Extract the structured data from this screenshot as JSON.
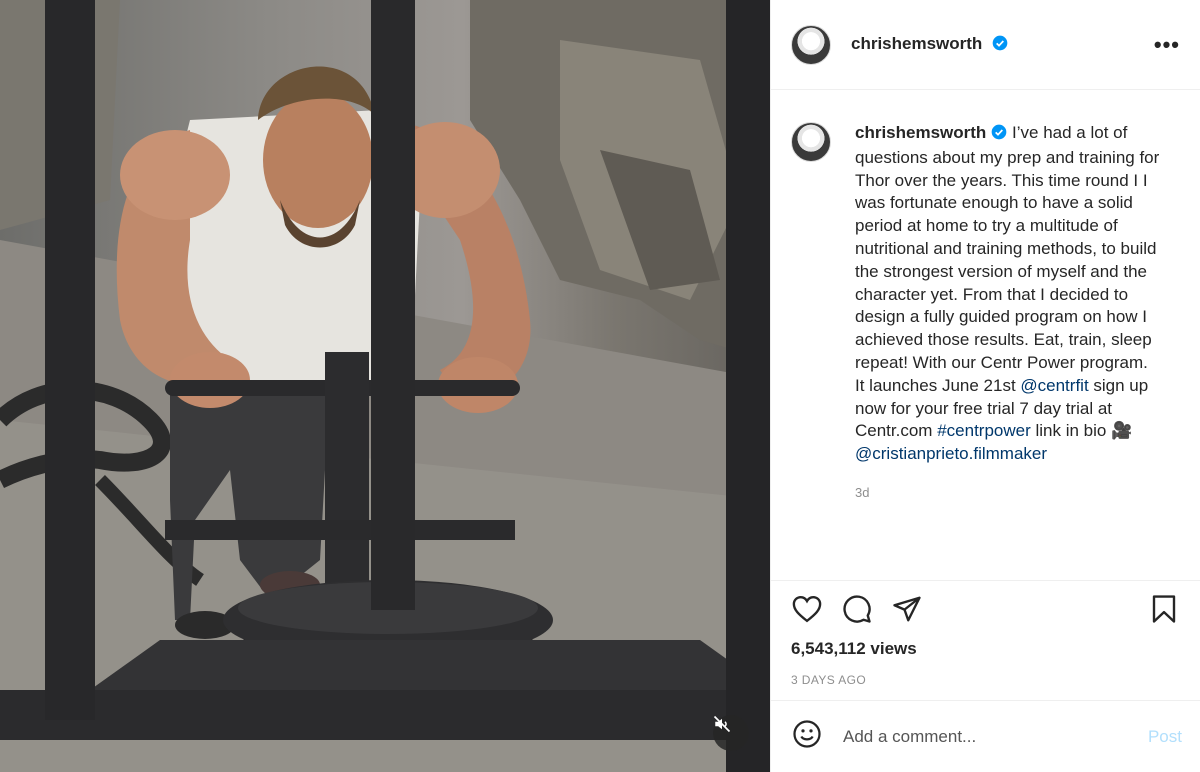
{
  "post": {
    "username": "chrishemsworth",
    "more_label": "•••",
    "caption": {
      "p1": " I’ve had a lot of questions about my prep and training for Thor over the years. This time round I I was fortunate enough to have a solid period at home to try a multitude of nutritional and training methods, to build the strongest version of myself and the character yet. From that I decided to design a fully guided program on how I achieved those results. Eat, train, sleep repeat! With our Centr Power program.",
      "p2_a": "It launches June 21st ",
      "mention_1": "@centrfit",
      "p2_b": " sign up now for your free trial 7 day trial at Centr.com ",
      "hashtag": "#centrpower",
      "p2_c": " link in bio 🎥",
      "mention_2": "@cristianprieto.filmmaker"
    },
    "caption_time": "3d",
    "views": "6,543,112 views",
    "date": "3 DAYS AGO"
  },
  "comment": {
    "placeholder": "Add a comment...",
    "post_label": "Post"
  },
  "colors": {
    "link": "#00376b",
    "verified": "#0095f6",
    "post_button": "#b2dffc"
  },
  "icons": [
    "heart-icon",
    "comment-icon",
    "share-icon",
    "bookmark-icon",
    "emoji-icon",
    "muted-icon",
    "verified-badge-icon"
  ]
}
